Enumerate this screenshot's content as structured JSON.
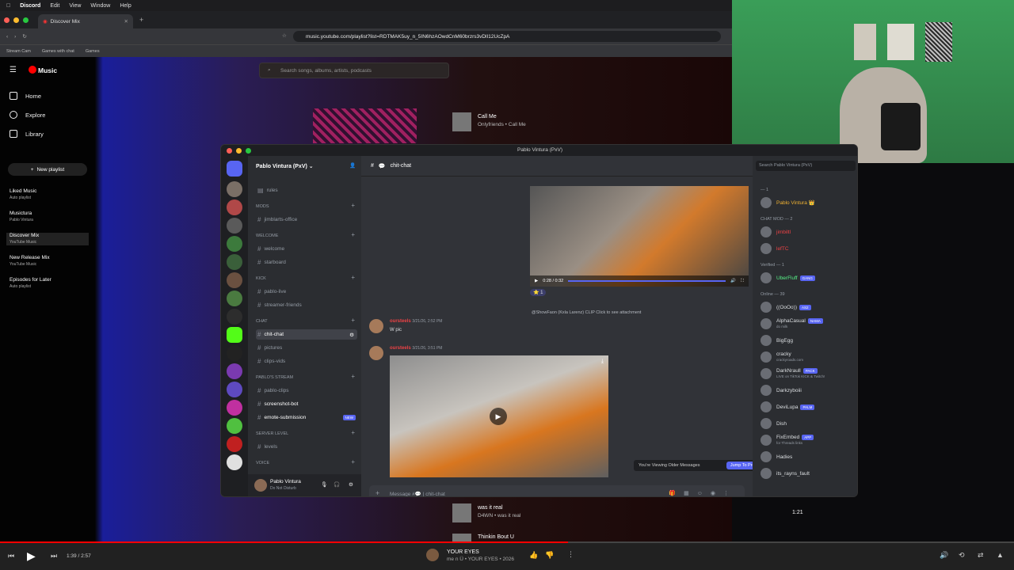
{
  "menubar": {
    "apple": "",
    "app": "Discord",
    "items": [
      "Edit",
      "View",
      "Window",
      "Help"
    ]
  },
  "browser": {
    "tab_title": "Discover Mix",
    "url": "music.youtube.com/playlist?list=RDTMAK5uy_n_5IN6hzAOwdCnM60brzrs3vDlI12UcZpA",
    "bookmarks": [
      "Stream Cam",
      "Games with chat",
      "Games"
    ]
  },
  "ytmusic": {
    "logo": "Music",
    "search_placeholder": "Search songs, albums, artists, podcasts",
    "nav": [
      "Home",
      "Explore",
      "Library"
    ],
    "new_playlist": "New playlist",
    "playlists": [
      {
        "name": "Liked Music",
        "sub": "Auto playlist"
      },
      {
        "name": "Musictura",
        "sub": "Pablo Vintura"
      },
      {
        "name": "Discover Mix",
        "sub": "YouTube Music"
      },
      {
        "name": "New Release Mix",
        "sub": "YouTube Music"
      },
      {
        "name": "Episodes for Later",
        "sub": "Auto playlist"
      }
    ],
    "tracks": [
      {
        "title": "Call Me",
        "artist": "Onlyfriends • Call Me"
      },
      {
        "title": "was it real",
        "artist": "D4WN • was it real",
        "duration": "1:21"
      },
      {
        "title": "Thinkin Bout U",
        "artist": ""
      }
    ],
    "player": {
      "time": "1:39 / 2:57",
      "title": "YOUR EYES",
      "artist": "me n Ü • YOUR EYES • 2026",
      "progress": 0.56
    }
  },
  "discord": {
    "window_title": "Pablo Vintura (PxV)",
    "server_name": "Pablo Vintura (PxV)",
    "channel": "chit-chat",
    "categories": [
      {
        "name": "MODS",
        "channels": [
          "jimblarts-office"
        ]
      },
      {
        "name": "WELCOME",
        "channels": [
          "welcome",
          "starboard"
        ]
      },
      {
        "name": "KICK",
        "channels": [
          "pablo-live",
          "streamer-friends"
        ]
      },
      {
        "name": "CHAT",
        "channels": [
          "chit-chat",
          "pictures",
          "clips-vids"
        ]
      },
      {
        "name": "PABLO'S STREAM",
        "channels": [
          "pablo-clips",
          "screenshot-bot",
          "emote-submission"
        ]
      },
      {
        "name": "SERVER LEVEL",
        "channels": [
          "levels"
        ]
      },
      {
        "name": "VOICE",
        "channels": []
      }
    ],
    "top_channel": "rules",
    "new_badge": "NEW",
    "video1_time": "0:28 / 0:32",
    "reaction_count": "1",
    "reply_preview": "@ShowFaon (Kxla Larenz)  CLIP  Click to see attachment",
    "msg1": {
      "author": "oursteels",
      "time": "3/21/26, 2:52 PM",
      "text": "W pic"
    },
    "msg2": {
      "author": "oursteels",
      "time": "3/21/26, 3:51 PM"
    },
    "older_notice": "You're Viewing Older Messages",
    "jump_label": "Jump To Present",
    "input_placeholder": "Message #💬 | chit-chat",
    "user": {
      "name": "Pablo Vintura",
      "status": "Do Not Disturb"
    },
    "member_search": "Search Pablo Vintura (PxV)",
    "member_groups": [
      {
        "label": "— 1",
        "members": [
          {
            "name": "Pablo Vintura 👑",
            "sub": "",
            "color": "#f0b232"
          }
        ]
      },
      {
        "label": "CHAT MOD — 2",
        "members": [
          {
            "name": "jimbiltl",
            "sub": "",
            "color": "#ed4245"
          },
          {
            "name": "lefTC",
            "sub": "",
            "color": "#ed4245"
          }
        ]
      },
      {
        "label": "Verified — 1",
        "members": [
          {
            "name": "UberFluff",
            "sub": "",
            "color": "#57f287",
            "badge": "GANG"
          }
        ]
      },
      {
        "label": "Online — 39",
        "members": [
          {
            "name": "((OoOo))",
            "sub": "",
            "color": "#dbdee1",
            "badge": "AS2"
          },
          {
            "name": "AlphaCasual",
            "sub": "do milk",
            "color": "#dbdee1",
            "badge": "NAMA"
          },
          {
            "name": "BigEgg",
            "sub": "",
            "color": "#dbdee1"
          },
          {
            "name": "cracky",
            "sub": "crackyroads.com",
            "color": "#dbdee1"
          },
          {
            "name": "DarkNraull",
            "sub": "LIVE on TikTok KICK & Twitch!",
            "color": "#dbdee1",
            "badge": "PACK"
          },
          {
            "name": "Darkzyboiii",
            "sub": "",
            "color": "#dbdee1"
          },
          {
            "name": "DeviLupa",
            "sub": "",
            "color": "#dbdee1",
            "badge": "PALM"
          },
          {
            "name": "Dish",
            "sub": "",
            "color": "#dbdee1"
          },
          {
            "name": "FixEmbed",
            "sub": "for Threads links",
            "color": "#dbdee1",
            "badge": "APP"
          },
          {
            "name": "Hadies",
            "sub": "",
            "color": "#dbdee1"
          },
          {
            "name": "its_rayns_fault",
            "sub": "",
            "color": "#dbdee1"
          }
        ]
      }
    ]
  }
}
